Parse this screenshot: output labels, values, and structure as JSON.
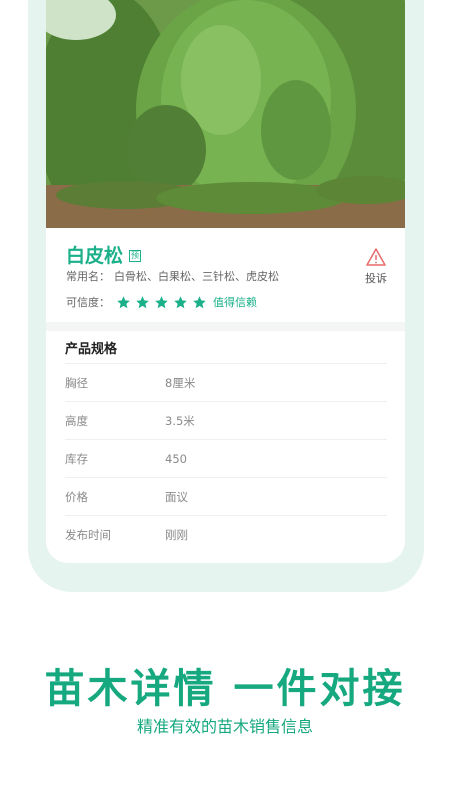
{
  "product": {
    "name": "白皮松",
    "badge": "预",
    "common_names_label": "常用名：",
    "common_names": [
      "白骨松、",
      "白果松、",
      "三针松、",
      "虎皮松"
    ],
    "complain_label": "投诉",
    "trust_label": "可信度：",
    "trust_stars": 5,
    "trust_text": "值得信赖"
  },
  "specs": {
    "title": "产品规格",
    "rows": [
      {
        "label": "胸径",
        "value": "8厘米"
      },
      {
        "label": "高度",
        "value": "3.5米"
      },
      {
        "label": "库存",
        "value": "450"
      },
      {
        "label": "价格",
        "value": "面议"
      },
      {
        "label": "发布时间",
        "value": "刚刚"
      }
    ]
  },
  "promo": {
    "headline": "苗木详情  一件对接",
    "subline": "精准有效的苗木销售信息"
  },
  "colors": {
    "accent": "#1bb08a",
    "frame": "#e5f4ef"
  },
  "icons": {
    "complain": "warning-triangle-icon",
    "star": "star-icon"
  }
}
